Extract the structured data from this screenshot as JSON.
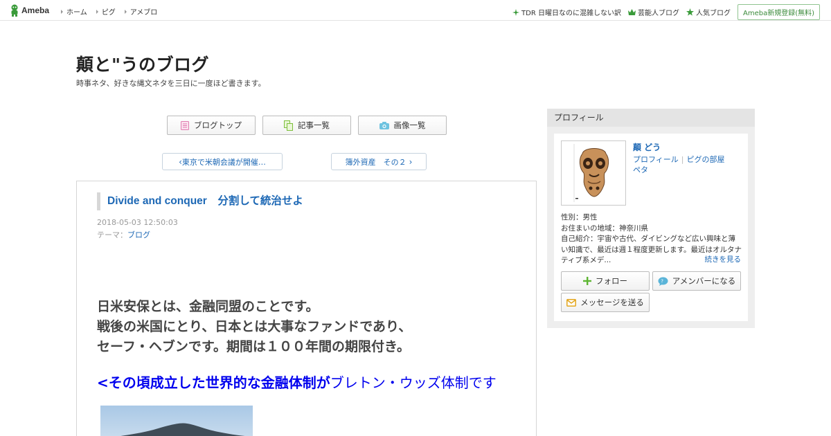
{
  "header": {
    "logo_text": "Ameba",
    "nav": [
      {
        "label": "ホーム"
      },
      {
        "label": "ピグ"
      },
      {
        "label": "アメブロ"
      }
    ],
    "right_links": [
      {
        "label": "TDR 日曜日なのに混雑しない訳",
        "icon": "sparkle-icon"
      },
      {
        "label": "芸能人ブログ",
        "icon": "crown-icon"
      },
      {
        "label": "人気ブログ",
        "icon": "star-icon"
      }
    ],
    "signup_label": "Ameba新規登録(無料)"
  },
  "blog": {
    "title": "顛と\"うのブログ",
    "description": "時事ネタ、好きな縄文ネタを三日に一度ほど書きます。"
  },
  "blog_nav": {
    "top_label": "ブログトップ",
    "list_label": "記事一覧",
    "images_label": "画像一覧"
  },
  "pager": {
    "prev_label": "東京で米朝会議が開催…",
    "next_label": "簿外資産　その２"
  },
  "entry": {
    "title": "Divide and conquer　分割して統治せよ",
    "date": "2018-05-03 12:50:03",
    "theme_prefix": "テーマ：",
    "theme_link": "ブログ",
    "body_lines": [
      "日米安保とは、金融同盟のことです。",
      "戦後の米国にとり、日本とは大事なファンドであり、",
      "セーフ・ヘブンです。期間は１００年間の期限付き。"
    ],
    "link_bold": "<その頃成立した世界的な金融体制が",
    "link_normal": "ブレトン・ウッズ体制です"
  },
  "profile": {
    "heading": "プロフィール",
    "name": "顛 どう",
    "link_profile": "プロフィール",
    "link_room": "ピグの部屋",
    "link_peta": "ペタ",
    "gender": "性別：男性",
    "location": "お住まいの地域：神奈川県",
    "intro": "自己紹介：宇宙や古代、ダイビングなど広い興味と薄い知識で、最近は週１程度更新します。最近はオルタナティブ系メデ...",
    "more_label": "続きを見る",
    "follow_label": "フォロー",
    "member_label": "アメンバーになる",
    "message_label": "メッセージを送る"
  },
  "colors": {
    "link_blue": "#1d68b5",
    "ameba_green": "#3a9b3a"
  }
}
